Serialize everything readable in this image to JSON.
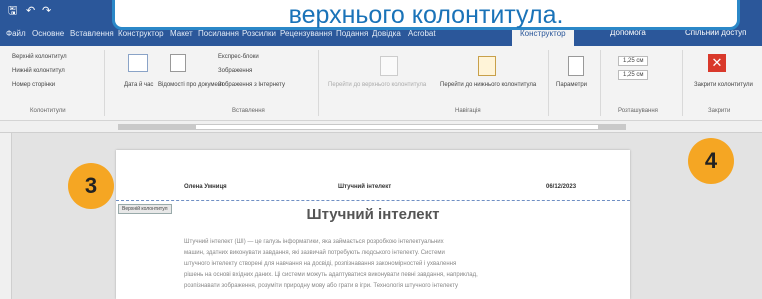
{
  "callout": {
    "text": "верхнього колонтитула."
  },
  "quick_access": {
    "save_icon": "save-icon",
    "undo_icon": "undo-icon",
    "redo_icon": "redo-icon",
    "undo_glyph": "↶",
    "redo_glyph": "↷",
    "save_glyph": "🖫"
  },
  "ribbon_tabs": [
    {
      "label": "Файл"
    },
    {
      "label": "Основне"
    },
    {
      "label": "Вставлення"
    },
    {
      "label": "Конструктор"
    },
    {
      "label": "Макет"
    },
    {
      "label": "Посилання"
    },
    {
      "label": "Розсилки"
    },
    {
      "label": "Рецензування"
    },
    {
      "label": "Подання"
    },
    {
      "label": "Довідка"
    },
    {
      "label": "Acrobat"
    },
    {
      "label": "Конструктор",
      "active": true
    }
  ],
  "tell_me": "Допомога",
  "share": "Спільний доступ",
  "ribbon": {
    "header_footer_group": {
      "label": "Колонтитули",
      "items": [
        "Верхній колонтитул",
        "Нижній колонтитул",
        "Номер сторінки"
      ]
    },
    "insert_group": {
      "label": "Вставлення",
      "date_time": "Дата й час",
      "doc_info": "Відомості про документ",
      "quick_parts": "Експрес-блоки",
      "pictures": "Зображення",
      "online_pictures": "Зображення з Інтернету"
    },
    "navigation_group": {
      "label": "Навігація",
      "goto_header": "Перейти до верхнього колонтитула",
      "goto_footer": "Перейти до нижнього колонтитула"
    },
    "options_group": {
      "label": "Параметри"
    },
    "position_group": {
      "label": "Розташування",
      "top_value": "1,25 см",
      "bottom_value": "1,25 см"
    },
    "close_group": {
      "label": "Закрити",
      "close_label": "Закрити колонтитули"
    }
  },
  "document": {
    "header_left": "Олена Умниця",
    "header_center": "Штучний інтелект",
    "header_right": "06/12/2023",
    "header_tag": "Верхній колонтитул",
    "title": "Штучний інтелект",
    "body_lines": [
      "Штучний інтелект (ШІ) — це галузь інформатики, яка займається розробкою інтелектуальних",
      "машин, здатних виконувати завдання, які зазвичай потребують людського інтелекту. Системи",
      "штучного інтелекту створені для навчання на досвіді, розпізнавання закономірностей і ухвалення",
      "рішень на основі вхідних даних. Ці системи можуть адаптуватися виконувати певні завдання, наприклад,",
      "розпізнавати зображення, розуміти природну мову або грати в ігри. Технологія штучного інтелекту"
    ]
  },
  "markers": [
    {
      "number": "3"
    },
    {
      "number": "4"
    }
  ],
  "colors": {
    "accent": "#2b579a",
    "marker": "#f5a623",
    "callout_border": "#2b88c8",
    "close_red": "#d9392b"
  }
}
